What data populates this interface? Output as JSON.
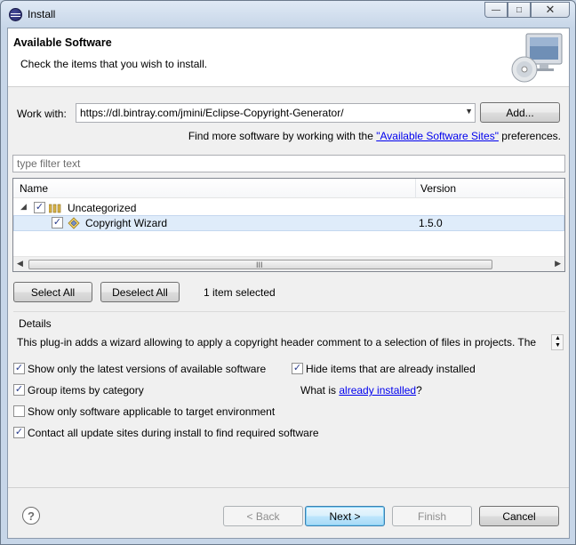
{
  "window": {
    "title": "Install",
    "min_glyph": "—",
    "max_glyph": "□",
    "close_glyph": "✕"
  },
  "header": {
    "title": "Available Software",
    "description": "Check the items that you wish to install."
  },
  "work_with": {
    "label": "Work with:",
    "value": "https://dl.bintray.com/jmini/Eclipse-Copyright-Generator/",
    "add_label": "Add...",
    "find_more_prefix": "Find more software by working with the",
    "find_more_link": "\"Available Software Sites\"",
    "find_more_suffix": "preferences."
  },
  "filter": {
    "placeholder": "type filter text"
  },
  "table": {
    "columns": [
      "Name",
      "Version"
    ],
    "rows": [
      {
        "expander": "◢",
        "checked": true,
        "name": "Uncategorized",
        "version": "",
        "icon": "category-icon"
      },
      {
        "checked": true,
        "name": "Copyright Wizard",
        "version": "1.5.0",
        "icon": "feature-icon"
      }
    ],
    "scroll_grip": "III",
    "scroll_left": "◀",
    "scroll_right": "▶"
  },
  "selection": {
    "select_all": "Select All",
    "deselect_all": "Deselect All",
    "status": "1 item selected"
  },
  "details": {
    "label": "Details",
    "text": "This plug-in adds a wizard allowing to apply a copyright header comment to a selection of files in projects. The"
  },
  "options": {
    "latest_versions": "Show only the latest versions of available software",
    "hide_installed": "Hide items that are already installed",
    "group_by_category": "Group items by category",
    "what_is_prefix": "What is",
    "what_is_link": "already installed",
    "what_is_suffix": "?",
    "applicable_only": "Show only software applicable to target environment",
    "contact_sites": "Contact all update sites during install to find required software"
  },
  "buttons": {
    "back": "< Back",
    "next": "Next >",
    "finish": "Finish",
    "cancel": "Cancel"
  },
  "checkbox_glyph": "✓",
  "help_glyph": "?"
}
